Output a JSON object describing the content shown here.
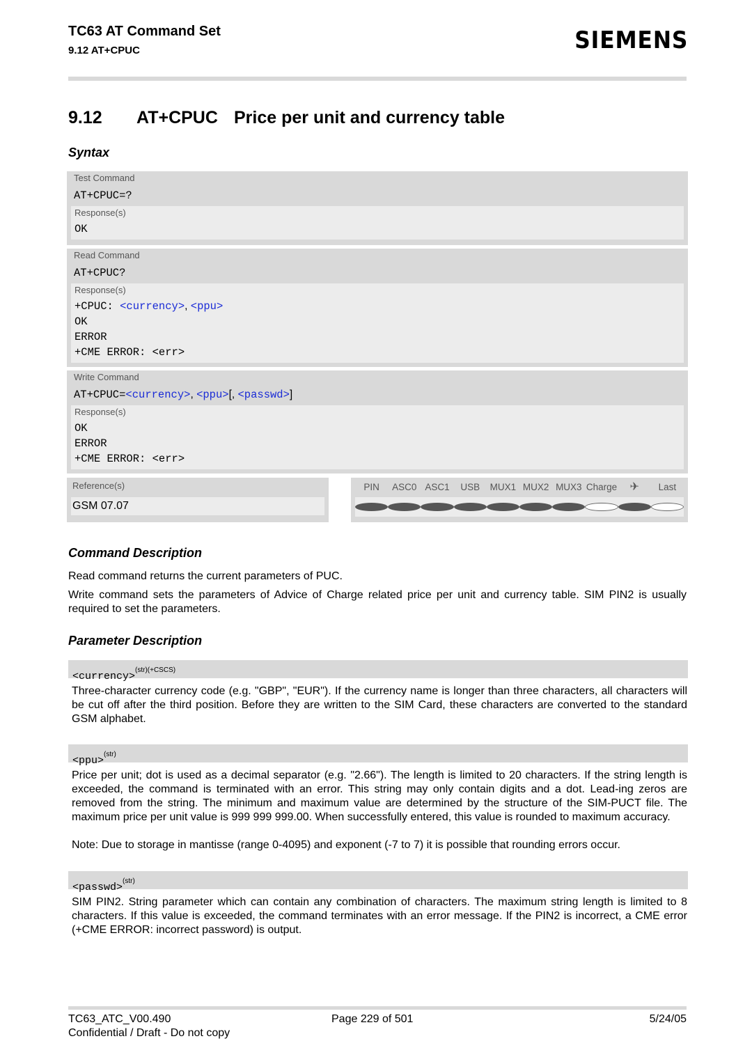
{
  "header": {
    "doc_title": "TC63 AT Command Set",
    "section": "9.12 AT+CPUC",
    "brand": "SIEMENS"
  },
  "heading": {
    "number": "9.12",
    "command": "AT+CPUC",
    "title": "Price per unit and currency table"
  },
  "syntax": {
    "title": "Syntax",
    "test": {
      "label": "Test Command",
      "command": "AT+CPUC=?",
      "responses_label": "Response(s)",
      "responses": [
        "OK"
      ]
    },
    "read": {
      "label": "Read Command",
      "command": "AT+CPUC?",
      "responses_label": "Response(s)",
      "response_prefix": "+CPUC: ",
      "param_currency": "<currency>",
      "sep": ", ",
      "param_ppu": "<ppu>",
      "responses": [
        "OK",
        "ERROR",
        "+CME ERROR: <err>"
      ]
    },
    "write": {
      "label": "Write Command",
      "command_prefix": "AT+CPUC=",
      "param_currency": "<currency>",
      "sep1": ", ",
      "param_ppu": "<ppu>",
      "opt_open": "[, ",
      "param_passwd": "<passwd>",
      "opt_close": "]",
      "responses_label": "Response(s)",
      "responses": [
        "OK",
        "ERROR",
        "+CME ERROR: <err>"
      ]
    },
    "references": {
      "label": "Reference(s)",
      "value": "GSM 07.07"
    },
    "status_columns": [
      {
        "label": "PIN",
        "supported": true
      },
      {
        "label": "ASC0",
        "supported": true
      },
      {
        "label": "ASC1",
        "supported": true
      },
      {
        "label": "USB",
        "supported": true
      },
      {
        "label": "MUX1",
        "supported": true
      },
      {
        "label": "MUX2",
        "supported": true
      },
      {
        "label": "MUX3",
        "supported": true
      },
      {
        "label": "Charge",
        "supported": false
      },
      {
        "label": "✈",
        "supported": true,
        "icon": "airplane-icon"
      },
      {
        "label": "Last",
        "supported": false
      }
    ]
  },
  "command_description": {
    "title": "Command Description",
    "paragraphs": [
      "Read command returns the current parameters of PUC.",
      "Write command sets the parameters of Advice of Charge related price per unit and currency table. SIM PIN2 is usually required to set the parameters."
    ]
  },
  "parameter_description": {
    "title": "Parameter Description",
    "params": [
      {
        "name": "<currency>",
        "sup": "(str)(+CSCS)",
        "text": "Three-character currency code (e.g. \"GBP\", \"EUR\"). If the currency name is longer than three characters, all characters will be cut off after the third position. Before they are written to the SIM Card, these characters are converted to the standard GSM alphabet."
      },
      {
        "name": "<ppu>",
        "sup": "(str)",
        "text": "Price per unit; dot is used as a decimal separator (e.g. \"2.66\"). The length is limited to 20 characters. If the string length is exceeded, the command is terminated with an error. This string may only contain digits and a dot. Lead-ing zeros are removed from the string. The minimum and maximum value are determined by the structure of the SIM-PUCT file. The maximum price per unit value is 999 999 999.00. When successfully entered, this value is rounded to maximum accuracy.",
        "note": "Note: Due to storage in mantisse (range 0-4095) and exponent (-7 to 7) it is possible that rounding errors occur."
      },
      {
        "name": "<passwd>",
        "sup": "(str)",
        "text": "SIM PIN2. String parameter which can contain any combination of characters. The maximum string length is limited to 8 characters. If this value is exceeded, the command terminates with an error message. If the PIN2 is incorrect, a CME error (+CME ERROR: incorrect password) is output."
      }
    ]
  },
  "footer": {
    "doc_id": "TC63_ATC_V00.490",
    "page": "Page 229 of 501",
    "date": "5/24/05",
    "confidential": "Confidential / Draft - Do not copy"
  }
}
